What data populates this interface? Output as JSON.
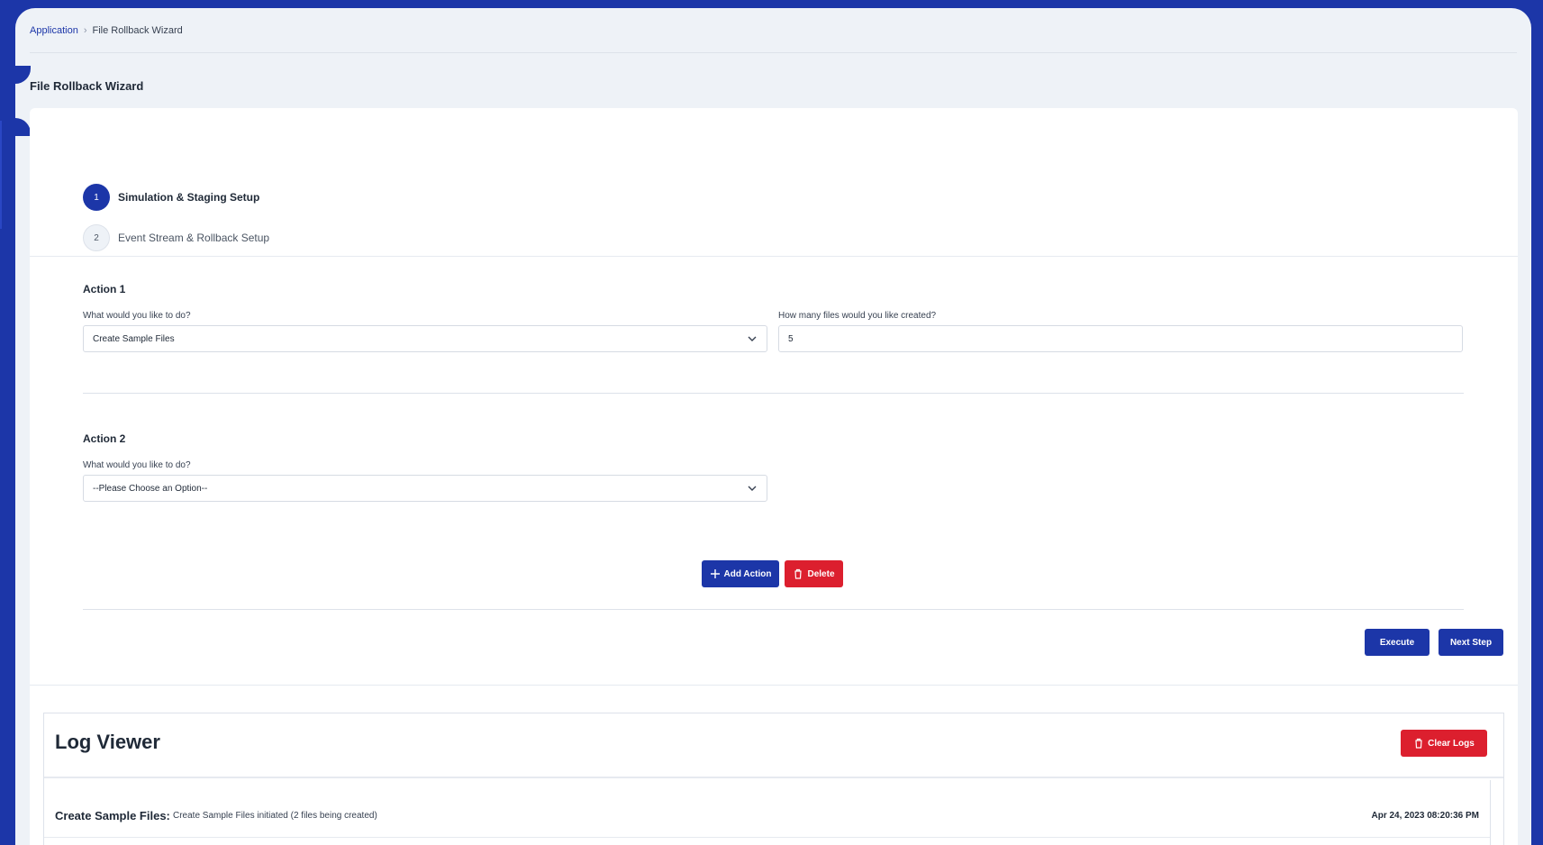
{
  "breadcrumb": {
    "root": "Application",
    "current": "File Rollback Wizard"
  },
  "page_title": "File Rollback Wizard",
  "stepper": {
    "steps": [
      {
        "number": "1",
        "label": "Simulation & Staging Setup",
        "state": "active"
      },
      {
        "number": "2",
        "label": "Event Stream & Rollback Setup",
        "state": "idle"
      }
    ]
  },
  "actions": [
    {
      "title": "Action 1",
      "what_label": "What would you like to do?",
      "what_value": "Create Sample Files",
      "count_label": "How many files would you like created?",
      "count_value": "5"
    },
    {
      "title": "Action 2",
      "what_label": "What would you like to do?",
      "what_value": "--Please Choose an Option--"
    }
  ],
  "buttons": {
    "add_action": "Add Action",
    "delete": "Delete",
    "execute": "Execute",
    "next_step": "Next Step",
    "clear_logs": "Clear Logs"
  },
  "log_viewer": {
    "title": "Log Viewer",
    "entries": [
      {
        "kind": "Create Sample Files:",
        "message": "Create Sample Files initiated (2 files being created)",
        "time": "Apr 24, 2023 08:20:36 PM"
      }
    ]
  },
  "colors": {
    "brand": "#1c36a8",
    "danger": "#dc1f2e",
    "background": "#eef2f7"
  }
}
